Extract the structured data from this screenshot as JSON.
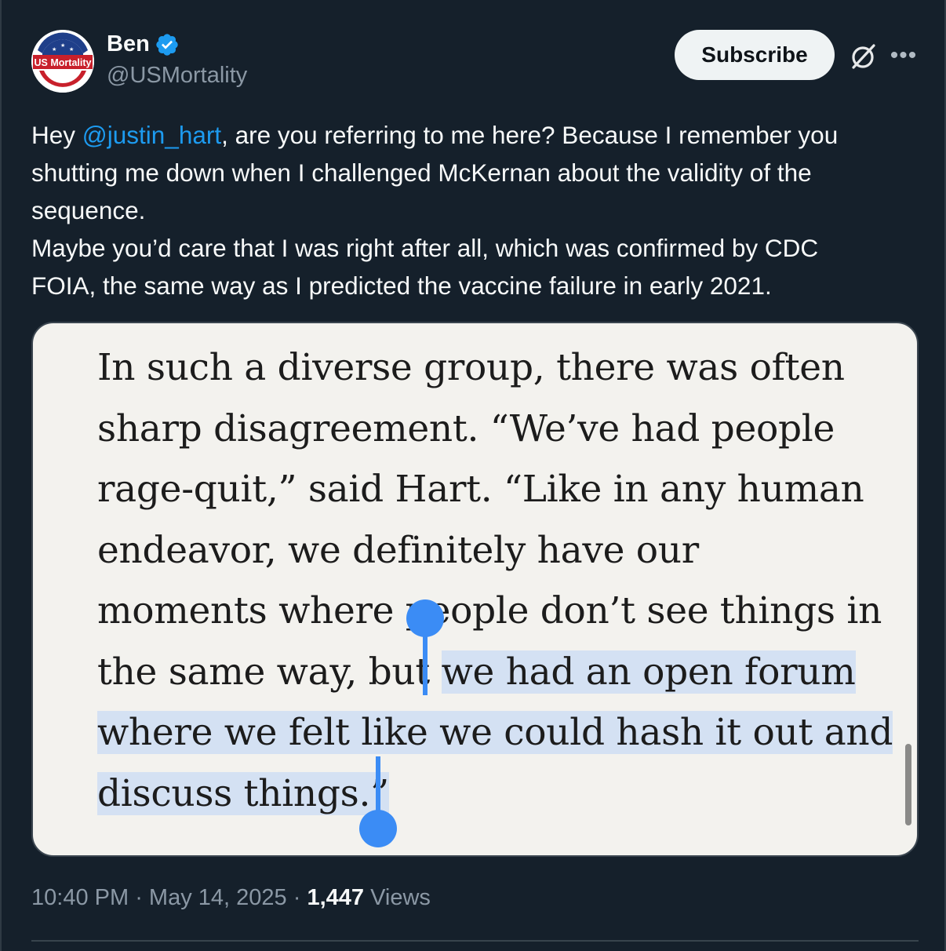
{
  "author": {
    "name": "Ben",
    "handle": "@USMortality",
    "avatar_text": "US Mortality",
    "verified_icon": "verified-badge-icon"
  },
  "header": {
    "subscribe_label": "Subscribe",
    "grok_icon": "grok-icon",
    "more_icon": "more-options-icon",
    "more_glyph": "•••"
  },
  "tweet": {
    "text_before_mention": "Hey ",
    "mention": "@justin_hart",
    "text_after_mention_line1": ", are you referring to me here? Because I remember you",
    "line2": "shutting me down when I challenged McKernan about the validity of the",
    "line3": "sequence.",
    "line4": "Maybe you’d care that I was right after all, which was confirmed by CDC",
    "line5": "FOIA, the same way as I predicted the vaccine failure in early 2021."
  },
  "media": {
    "lines": [
      "In such a diverse group, there was often",
      "sharp disagreement. “We’ve had people",
      "rage-quit,” said Hart. “Like in any human",
      "endeavor, we definitely have our",
      "moments where people don’t see things in"
    ],
    "line6_plain": "the same way, but ",
    "line6_selected": "we had an open forum",
    "line7_selected": "where we felt like we could hash it out and",
    "line8_selected": "discuss things.”"
  },
  "meta": {
    "time": "10:40 PM",
    "sep1": " · ",
    "date": "May 14, 2025",
    "sep2": " · ",
    "views_count": "1,447",
    "views_label": " Views"
  },
  "colors": {
    "background": "#15202b",
    "mention": "#1d9bf0",
    "selection": "#d4e1f3",
    "selection_handle": "#3b8cf5",
    "verified": "#1d9bf0"
  }
}
